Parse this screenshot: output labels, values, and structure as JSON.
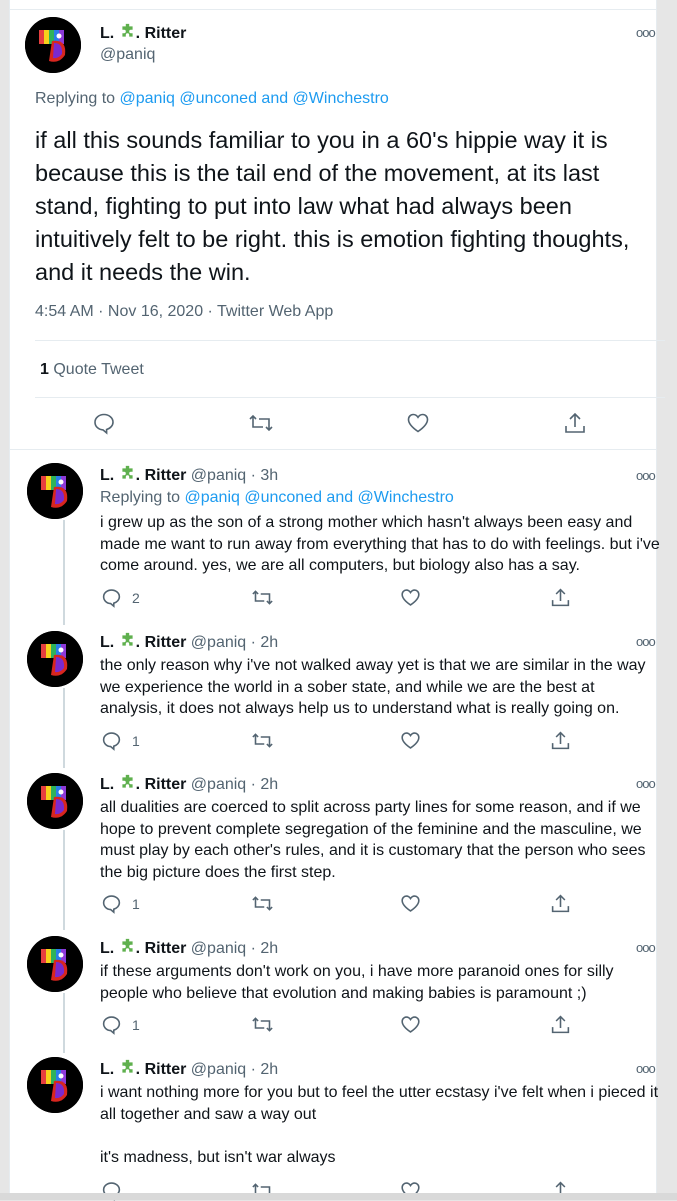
{
  "main": {
    "name_prefix": "L.",
    "name_suffix": ". Ritter",
    "handle": "@paniq",
    "replying_label": "Replying to",
    "replying_to": "@paniq @unconed and @Winchestro",
    "text": "if all this sounds familiar to you in a 60's hippie way it is because this is the tail end of the movement, at its last stand, fighting to put into law what had always been intuitively felt to be right. this is emotion fighting thoughts, and it needs the win.",
    "timestamp": "4:54 AM · Nov 16, 2020 · Twitter Web App",
    "quote_count": "1",
    "quote_label": "Quote Tweet",
    "more": "ooo"
  },
  "replies": [
    {
      "name_prefix": "L.",
      "name_suffix": ". Ritter",
      "handle_time": "@paniq · 3h",
      "replying_label": "Replying to",
      "replying_to": "@paniq @unconed and @Winchestro",
      "text": "i grew up as the son of a strong mother which hasn't always been easy and made me want to run away from everything that has to do with feelings. but i've come around. yes, we are all computers, but biology also has a say.",
      "reply_count": "2",
      "more": "ooo"
    },
    {
      "name_prefix": "L.",
      "name_suffix": ". Ritter",
      "handle_time": "@paniq · 2h",
      "text": "the only reason why i've not walked away yet is that we are similar in the way we experience the world in a sober state, and while we are the best at analysis, it does not always help us to understand what is really going on.",
      "reply_count": "1",
      "more": "ooo"
    },
    {
      "name_prefix": "L.",
      "name_suffix": ". Ritter",
      "handle_time": "@paniq · 2h",
      "text": "all dualities are coerced to split across party lines for some reason, and if we hope to prevent complete segregation of the feminine and the masculine, we must play by each other's rules, and it is customary that the person who sees the big picture does the first step.",
      "reply_count": "1",
      "more": "ooo"
    },
    {
      "name_prefix": "L.",
      "name_suffix": ". Ritter",
      "handle_time": "@paniq · 2h",
      "text": "if these arguments don't work on you, i have more paranoid ones for silly people who believe that evolution and making babies is paramount ;)",
      "reply_count": "1",
      "more": "ooo"
    },
    {
      "name_prefix": "L.",
      "name_suffix": ". Ritter",
      "handle_time": "@paniq · 2h",
      "text": "i want nothing more for you but to feel the utter ecstasy i've felt when i pieced it all together and saw a way out\n\nit's madness, but isn't war always",
      "reply_count": "",
      "more": "ooo"
    }
  ],
  "colors": {
    "link": "#1d9bf0",
    "muted": "#536471",
    "puzzle": "#5fb04e"
  },
  "icons": [
    "reply-icon",
    "retweet-icon",
    "like-icon",
    "share-icon",
    "puzzle-icon",
    "more-icon"
  ]
}
